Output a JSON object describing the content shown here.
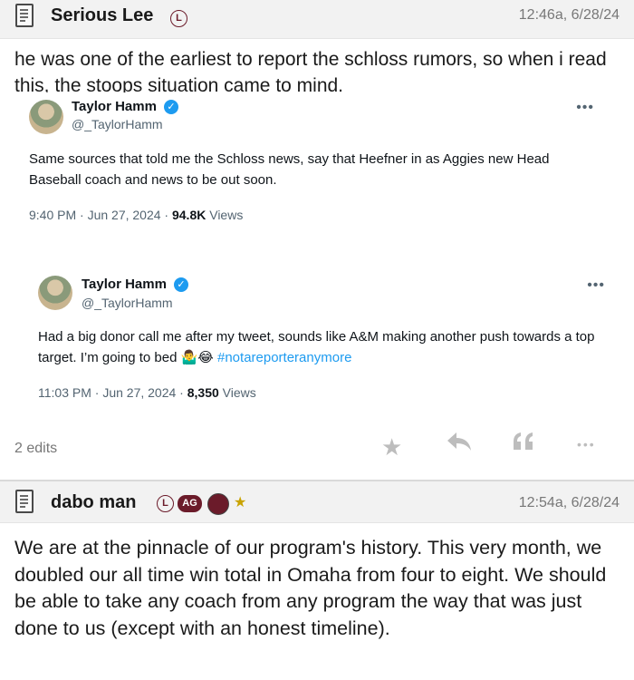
{
  "post1": {
    "username": "Serious Lee",
    "badge": "L",
    "timestamp": "12:46a, 6/28/24",
    "body": "he was one of the earliest to report the schloss rumors, so when i read this, the stoops situation came to mind.",
    "edits": "2 edits"
  },
  "tweet1": {
    "name": "Taylor Hamm",
    "handle": "@_TaylorHamm",
    "text": "Same sources that told me the Schloss news, say that Heefner in as Aggies new Head Baseball coach and news to be out soon.",
    "time": "9:40 PM · Jun 27, 2024 · ",
    "views_count": "94.8K",
    "views_label": " Views"
  },
  "tweet2": {
    "name": "Taylor Hamm",
    "handle": "@_TaylorHamm",
    "text": "Had a big donor call me after my tweet, sounds like A&M making another push towards a top target. I’m going to bed ",
    "emojis": "🤷‍♂️😂",
    "hashtag": " #notareporteranymore",
    "time": "11:03 PM · Jun 27, 2024 · ",
    "views_count": "8,350",
    "views_label": " Views"
  },
  "post2": {
    "username": "dabo man",
    "badge_l": "L",
    "badge_ag": "AG",
    "star": "★",
    "timestamp": "12:54a, 6/28/24",
    "body": "We are at the pinnacle of our program's history. This very month, we doubled our all time win total in Omaha from four to eight. We should be able to take any coach from any program the way that was just done to us (except with an honest timeline)."
  },
  "icons": {
    "more": "•••",
    "star_action": "★",
    "reply": "reply-icon",
    "quote": "quote-icon"
  }
}
